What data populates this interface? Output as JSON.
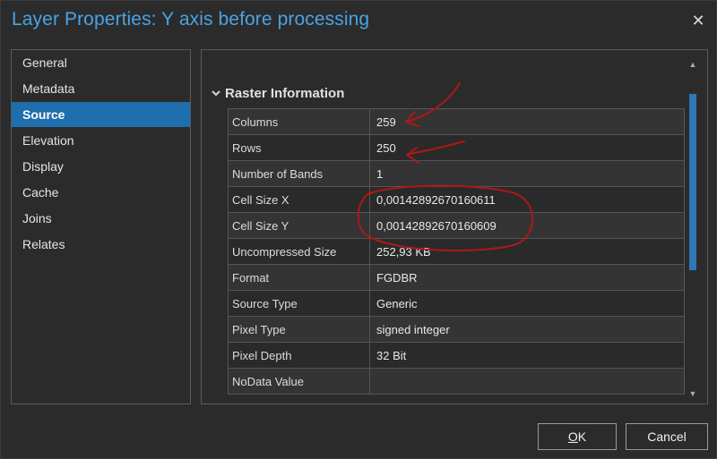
{
  "window": {
    "title": "Layer Properties: Y axis before processing",
    "close_glyph": "✕"
  },
  "sidebar": {
    "items": [
      {
        "label": "General"
      },
      {
        "label": "Metadata"
      },
      {
        "label": "Source",
        "selected": true
      },
      {
        "label": "Elevation"
      },
      {
        "label": "Display"
      },
      {
        "label": "Cache"
      },
      {
        "label": "Joins"
      },
      {
        "label": "Relates"
      }
    ]
  },
  "section": {
    "title": "Raster Information",
    "icon": "chevron-down-icon",
    "rows": [
      {
        "label": "Columns",
        "value": "259"
      },
      {
        "label": "Rows",
        "value": "250"
      },
      {
        "label": "Number of Bands",
        "value": "1"
      },
      {
        "label": "Cell Size X",
        "value": "0,00142892670160611"
      },
      {
        "label": "Cell Size Y",
        "value": "0,00142892670160609"
      },
      {
        "label": "Uncompressed Size",
        "value": "252,93 KB"
      },
      {
        "label": "Format",
        "value": "FGDBR"
      },
      {
        "label": "Source Type",
        "value": "Generic"
      },
      {
        "label": "Pixel Type",
        "value": "signed integer"
      },
      {
        "label": "Pixel Depth",
        "value": "32 Bit"
      },
      {
        "label": "NoData Value",
        "value": ""
      }
    ]
  },
  "scrollbar": {
    "up_glyph": "▲",
    "down_glyph": "▼"
  },
  "buttons": {
    "ok_accel": "O",
    "ok_rest": "K",
    "cancel": "Cancel"
  },
  "colors": {
    "title": "#49a3e6",
    "selection": "#1f6fae",
    "scroll_thumb": "#2e78b8",
    "annotation": "#b01717"
  }
}
